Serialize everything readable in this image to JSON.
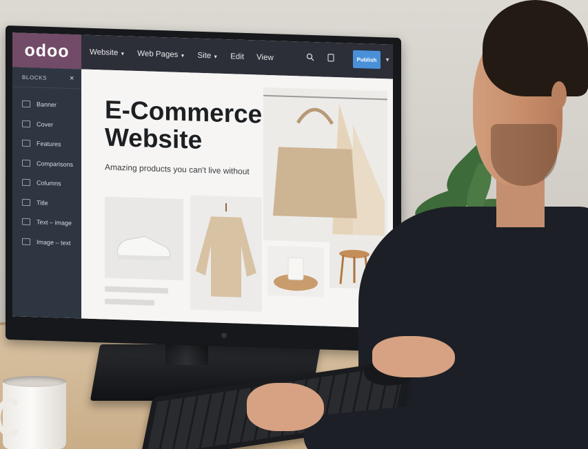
{
  "window": {
    "logo": "odoo",
    "menu": [
      {
        "label": "Website",
        "has_caret": true
      },
      {
        "label": "Web Pages",
        "has_caret": true
      },
      {
        "label": "Site",
        "has_caret": true
      },
      {
        "label": "Edit",
        "has_caret": false
      },
      {
        "label": "View",
        "has_caret": false
      }
    ],
    "icons": [
      "search-icon",
      "mobile-preview-icon"
    ],
    "publish_label": "Publish"
  },
  "sidebar": {
    "header": "BLOCKS",
    "close_glyph": "×",
    "items": [
      {
        "label": "Banner",
        "icon": "banner-icon"
      },
      {
        "label": "Cover",
        "icon": "cover-icon"
      },
      {
        "label": "Features",
        "icon": "features-icon"
      },
      {
        "label": "Comparisons",
        "icon": "comparisons-icon"
      },
      {
        "label": "Columns",
        "icon": "columns-icon"
      },
      {
        "label": "Title",
        "icon": "title-icon"
      },
      {
        "label": "Text – image",
        "icon": "text-image-icon"
      },
      {
        "label": "Image – text",
        "icon": "image-text-icon"
      }
    ]
  },
  "page": {
    "hero_title": "E-Commerce Website",
    "hero_subtitle": "Amazing products you can't live without",
    "product_images": [
      "sneaker",
      "sweater",
      "handbag",
      "cup",
      "stool"
    ]
  },
  "colors": {
    "brand": "#714b67",
    "topbar": "#2c2f38",
    "sidebar": "#2e3641",
    "publish": "#4a90d9"
  }
}
